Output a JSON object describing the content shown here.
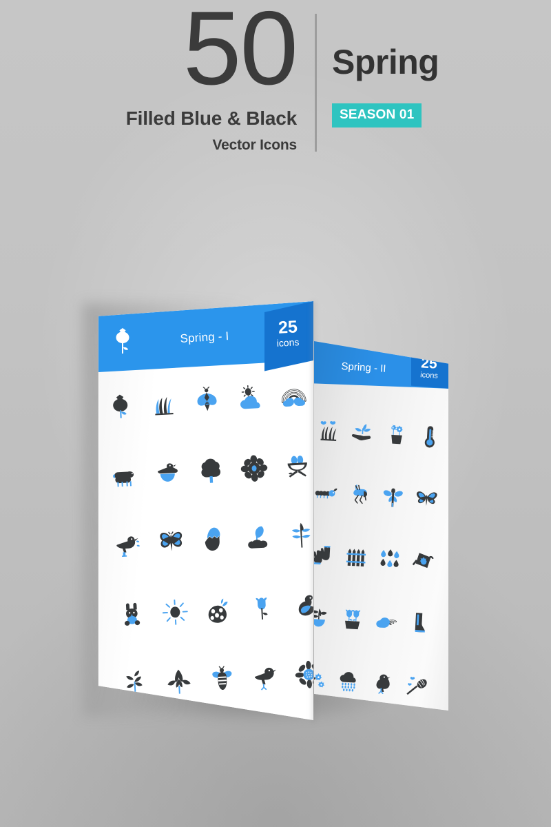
{
  "background": {
    "color": "#c2c2c2"
  },
  "header": {
    "count": "50",
    "subtitle_line1": "Filled Blue & Black",
    "subtitle_line2": "Vector Icons",
    "theme": "Spring",
    "season_badge": "SEASON 01",
    "divider_color": "#9d9d9d",
    "badge_color": "#2ec4c0",
    "text_color": "#3b3b3b"
  },
  "colors": {
    "blue": "#2b95ec",
    "blue_dark": "#1573cf",
    "icon_black": "#373a3c",
    "icon_blue": "#4aa3f0",
    "card_white": "#ffffff",
    "card_gray": "#eeeeee"
  },
  "cards": [
    {
      "id": "spring-1",
      "header_icon": "rose-icon",
      "title": "Spring - I",
      "count": "25",
      "count_label": "icons",
      "columns": 5,
      "rows": 5,
      "icons": [
        "rose-icon",
        "grass-icon",
        "moth-icon",
        "sun-cloud-icon",
        "rainbow-icon",
        "sheep-icon",
        "duck-nest-icon",
        "tree-icon",
        "flower-icon",
        "nest-eggs-icon",
        "bird-worm-icon",
        "butterfly-icon",
        "cracked-egg-icon",
        "sprout-soil-icon",
        "leaf-branch-blue-icon",
        "rabbit-icon",
        "sun-icon",
        "decorated-egg-icon",
        "tulip-icon",
        "duck-icon",
        "leafy-branch-icon",
        "leaf-icon",
        "bee-icon",
        "songbird-icon",
        "daisy-icon"
      ]
    },
    {
      "id": "spring-2",
      "title": "Spring - II",
      "count": "25",
      "count_label": "icons",
      "columns": 4,
      "rows": 5,
      "icons": [
        "grass-butterflies-icon",
        "hand-sprout-icon",
        "flower-pot-icon",
        "thermometer-icon",
        "caterpillar-icon",
        "grasshopper-icon",
        "dragonfly-icon",
        "butterfly-2-icon",
        "gardening-gloves-icon",
        "fence-icon",
        "raindrops-icon",
        "watering-can-icon",
        "potted-plant-icon",
        "tulips-pot-icon",
        "cloud-rainbow-icon",
        "rain-boot-icon",
        "blossom-branch-icon",
        "rain-cloud-icon",
        "bird-perched-icon",
        "butterfly-net-icon"
      ]
    }
  ]
}
